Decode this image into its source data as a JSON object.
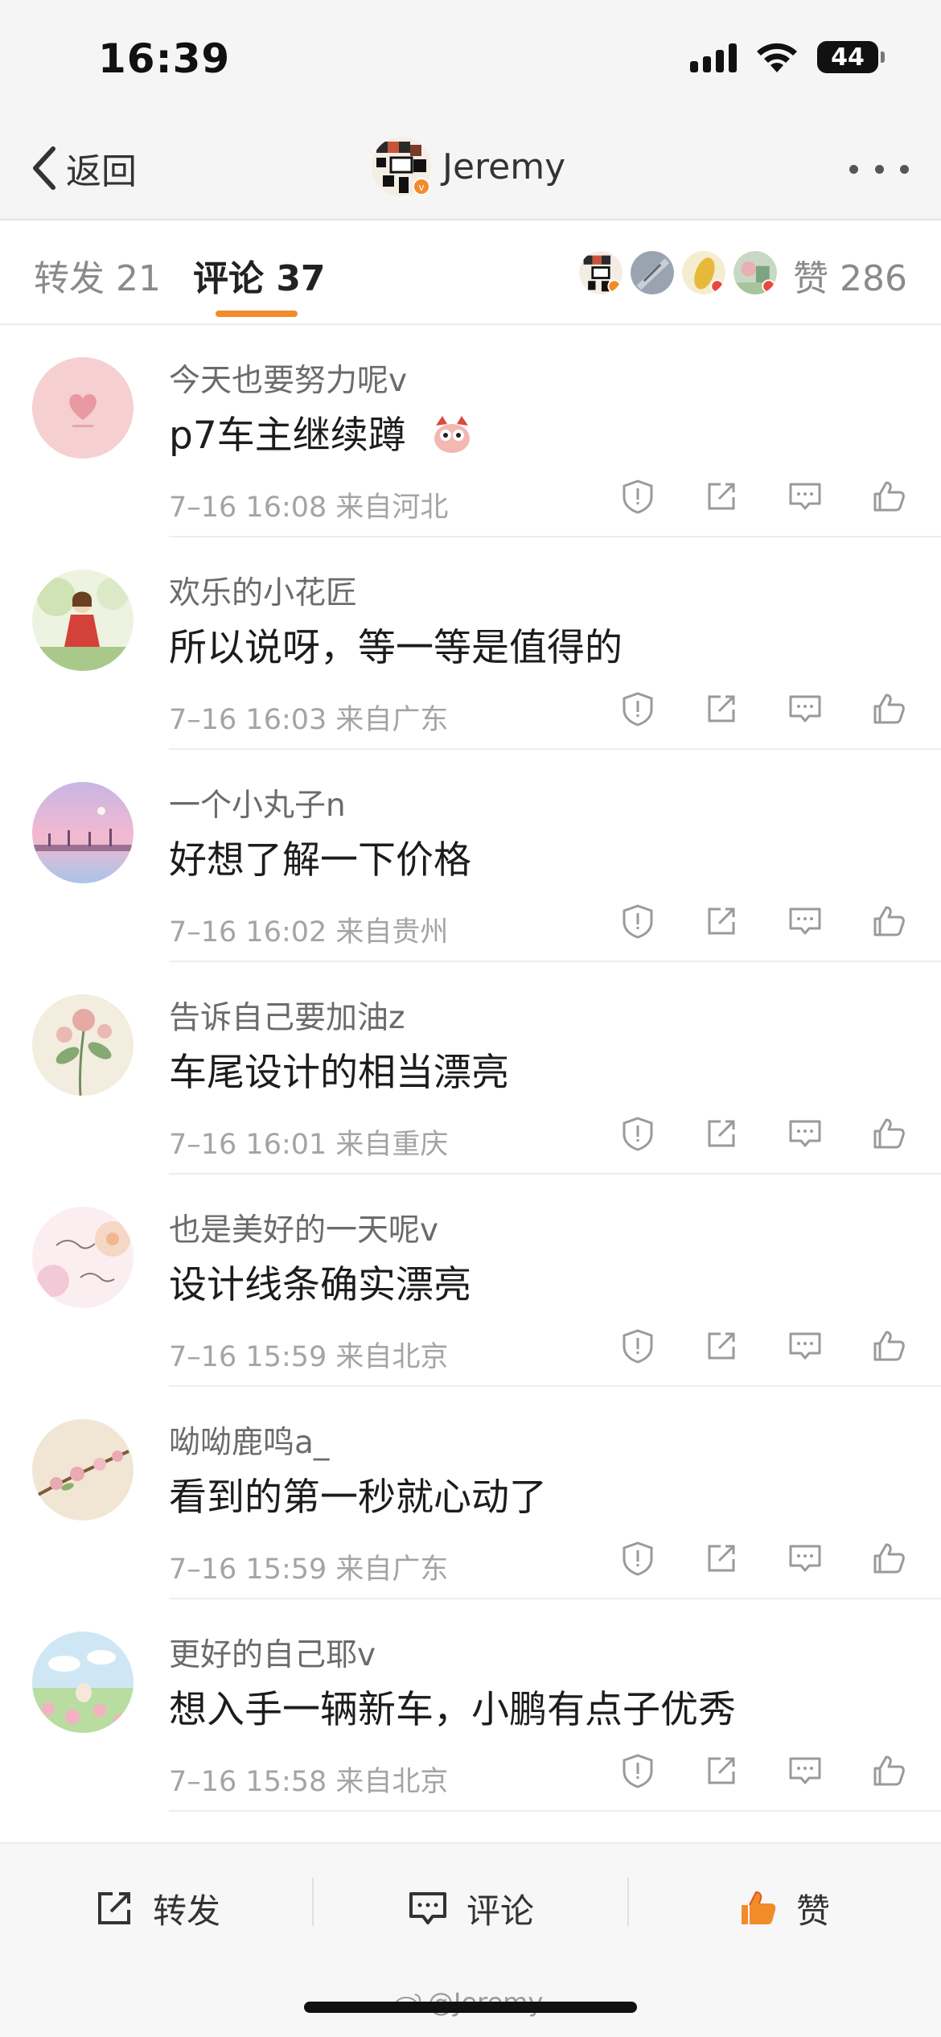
{
  "status_bar": {
    "time": "16:39",
    "battery": "44"
  },
  "nav": {
    "back_label": "返回",
    "username": "Jeremy"
  },
  "tabs": {
    "repost_label": "转发 21",
    "comment_label": "评论 37",
    "likes_label": "赞 286",
    "active_color": "#f28b2a"
  },
  "comments": [
    {
      "name": "今天也要努力呢v",
      "text": "p7车主继续蹲",
      "time": "7-16 16:08",
      "location": "来自河北",
      "meta": "7–16 16:08  来自河北"
    },
    {
      "name": "欢乐的小花匠",
      "text": "所以说呀，等一等是值得的",
      "meta": "7–16 16:03  来自广东"
    },
    {
      "name": "一个小丸子n",
      "text": "好想了解一下价格",
      "meta": "7–16 16:02  来自贵州"
    },
    {
      "name": "告诉自己要加油z",
      "text": "车尾设计的相当漂亮",
      "meta": "7–16 16:01  来自重庆"
    },
    {
      "name": "也是美好的一天呢v",
      "text": "设计线条确实漂亮",
      "meta": "7–16 15:59  来自北京"
    },
    {
      "name": "呦呦鹿鸣a_",
      "text": "看到的第一秒就心动了",
      "meta": "7–16 15:59  来自广东"
    },
    {
      "name": "更好的自己耶v",
      "text": "想入手一辆新车，小鹏有点子优秀",
      "meta": "7–16 15:58  来自北京"
    }
  ],
  "bottom_bar": {
    "repost_label": "转发",
    "comment_label": "评论",
    "like_label": "赞",
    "like_color": "#f28b2a"
  },
  "watermark": "@Jeremy"
}
